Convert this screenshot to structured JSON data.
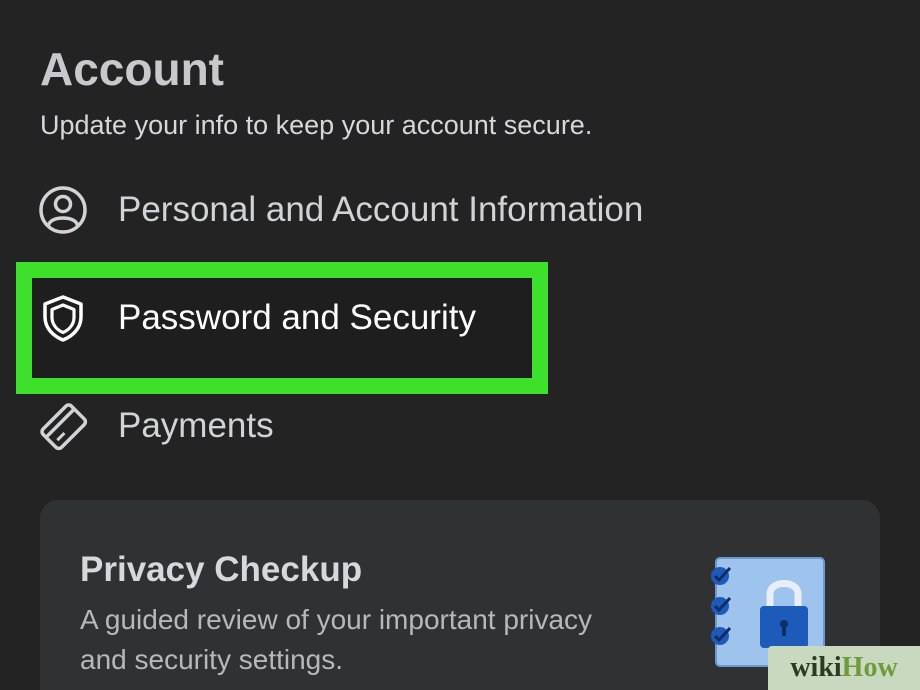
{
  "section": {
    "title": "Account",
    "subtitle": "Update your info to keep your account secure."
  },
  "menu": {
    "items": [
      {
        "label": "Personal and Account Information",
        "icon": "user-circle-icon"
      },
      {
        "label": "Password and Security",
        "icon": "shield-icon"
      },
      {
        "label": "Payments",
        "icon": "credit-card-icon"
      }
    ]
  },
  "highlight": {
    "color": "#3de02a",
    "target": "Password and Security"
  },
  "privacy_card": {
    "title": "Privacy Checkup",
    "description": "A guided review of your important privacy and security settings.",
    "illustration": "checklist-lock-icon"
  },
  "watermark": {
    "prefix": "wiki",
    "suffix": "How"
  },
  "colors": {
    "background": "#232324",
    "card": "#303132",
    "accent_illustration": "#3b7bd6"
  }
}
